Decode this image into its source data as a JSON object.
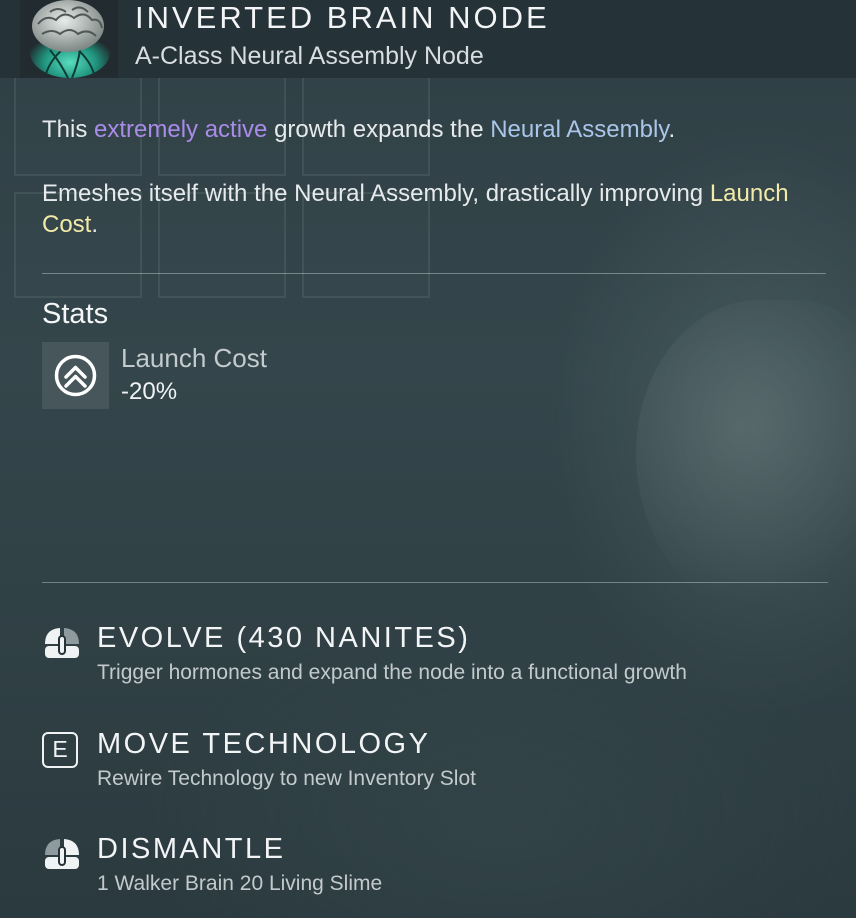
{
  "header": {
    "title": "INVERTED BRAIN NODE",
    "subtitle": "A-Class Neural Assembly Node",
    "thumbnail_icon": "brain-icon"
  },
  "description": {
    "line1_part1": "This ",
    "line1_highlight1": "extremely active",
    "line1_part2": " growth expands the ",
    "line1_highlight2": "Neural Assembly",
    "line1_part3": ".",
    "line2_part1": "Emeshes itself with the Neural Assembly, drastically improving ",
    "line2_highlight": "Launch Cost",
    "line2_part2": "."
  },
  "stats": {
    "heading": "Stats",
    "items": [
      {
        "icon": "double-chevron-up-icon",
        "name": "Launch Cost",
        "value": "-20%"
      }
    ]
  },
  "actions": [
    {
      "icon": "mouse-icon",
      "title": "EVOLVE (430 NANITES)",
      "description": "Trigger hormones and expand the node into a functional growth"
    },
    {
      "icon": "e-key-icon",
      "key": "E",
      "title": "MOVE TECHNOLOGY",
      "description": "Rewire Technology to new Inventory Slot"
    },
    {
      "icon": "mouse-icon",
      "title": "DISMANTLE",
      "description": "1 Walker Brain 20 Living Slime"
    }
  ],
  "colors": {
    "highlight_purple": "#a98bea",
    "highlight_blue": "#a9c6ea",
    "highlight_yellow": "#f2eaa8",
    "thumbnail_glow": "#2fd3b0"
  }
}
